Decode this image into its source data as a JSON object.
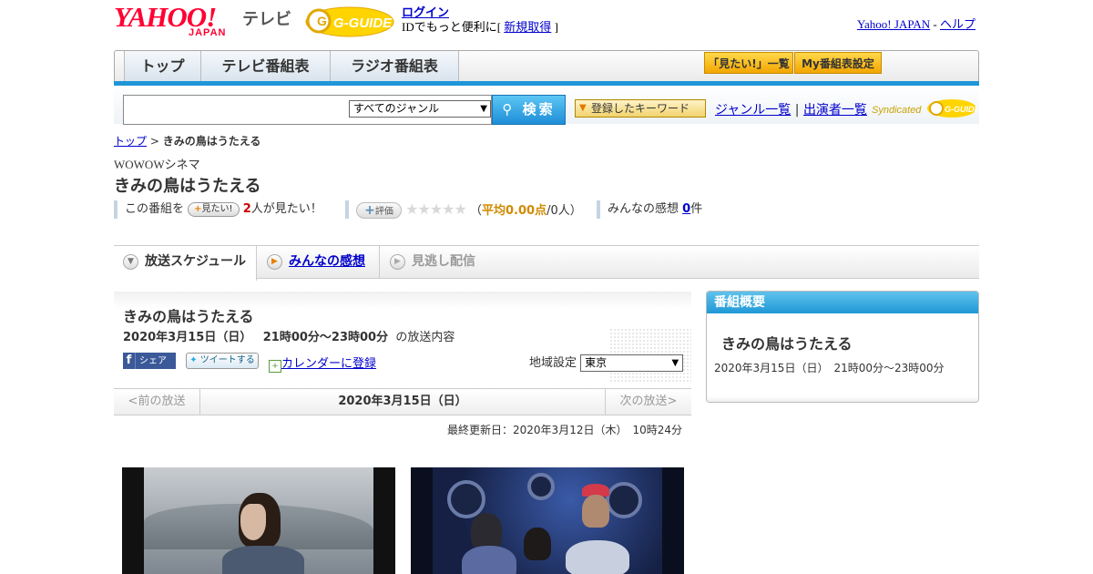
{
  "header": {
    "logo_word": "YAHOO!",
    "logo_sub": "JAPAN",
    "service": "テレビ",
    "gguide": "G-GUIDE",
    "login": "ログイン",
    "login_desc_pre": "IDでもっと便利に[ ",
    "register": "新規取得",
    "login_desc_post": " ]",
    "yahoo_japan": "Yahoo! JAPAN",
    "sep": " - ",
    "help": "ヘルプ"
  },
  "nav": {
    "tabs": [
      "トップ",
      "テレビ番組表",
      "ラジオ番組表"
    ],
    "want_list": "「見たい!」一覧",
    "my_schedule": "My番組表設定"
  },
  "search": {
    "genre": "すべてのジャンル",
    "button": "検索",
    "keyword": "登録したキーワード",
    "genre_list": "ジャンル一覧",
    "divider": "|",
    "performers": "出演者一覧",
    "syndicated": "Syndicated"
  },
  "breadcrumb": {
    "top": "トップ",
    "sep": " > ",
    "current": "きみの鳥はうたえる"
  },
  "program": {
    "channel": "WOWOWシネマ",
    "title": "きみの鳥はうたえる"
  },
  "stats": {
    "this_program": "この番組を",
    "want_btn": "見たい!",
    "want_count": "2",
    "want_suffix": "人が見たい！",
    "rate_btn": "評価",
    "stars": "★★★★★",
    "avg_pre": "（",
    "avg": "平均0.00点",
    "avg_post": "/0人）",
    "impressions": "みんなの感想",
    "imp_count": "0",
    "imp_suffix": "件"
  },
  "subtabs": {
    "schedule": "放送スケジュール",
    "impressions": "みんなの感想",
    "vod": "見逃し配信"
  },
  "detail": {
    "title": "きみの鳥はうたえる",
    "date": "2020年3月15日（日）",
    "time": "21時00分～23時00分",
    "suffix": "の放送内容",
    "fb": "シェア",
    "tweet": "ツイートする",
    "calendar": "カレンダーに登録",
    "region_label": "地域設定",
    "region": "東京"
  },
  "datenav": {
    "prev": "<前の放送",
    "current": "2020年3月15日（日）",
    "next": "次の放送>"
  },
  "updated": "最終更新日：2020年3月12日（木）　10時24分",
  "side": {
    "header": "番組概要",
    "title": "きみの鳥はうたえる",
    "when": "2020年3月15日（日）　21時00分～23時00分"
  }
}
